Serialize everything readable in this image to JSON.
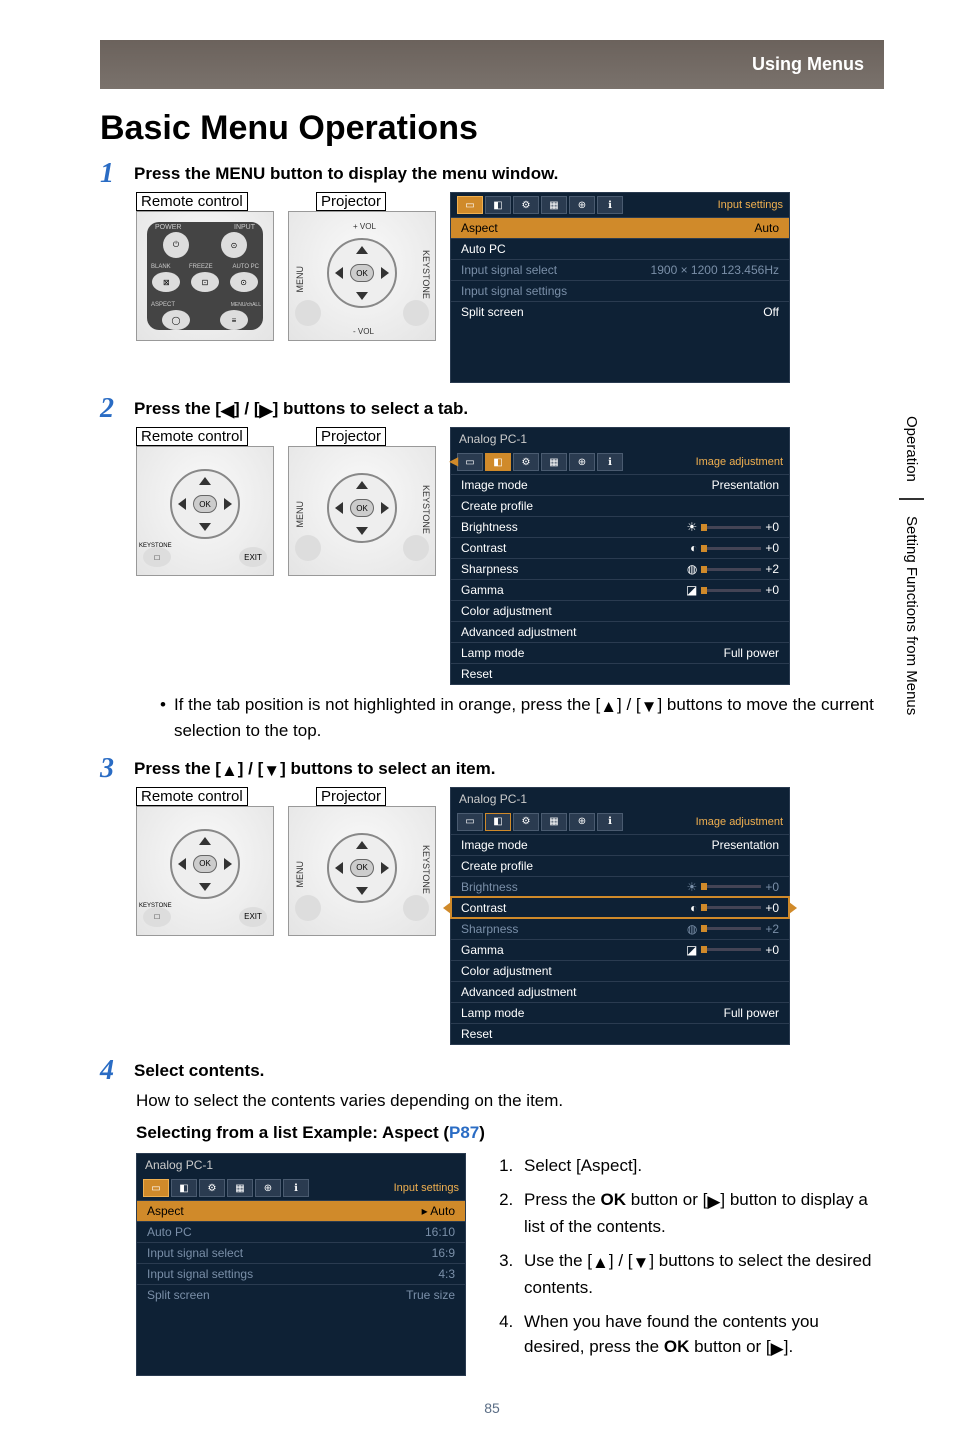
{
  "header": {
    "section": "Using Menus"
  },
  "title": "Basic Menu Operations",
  "side_tabs": [
    "Operation",
    "Setting Functions from Menus"
  ],
  "steps": {
    "s1": {
      "num": "1",
      "text": "Press the MENU button to display the menu window.",
      "remote_label": "Remote control",
      "projector_label": "Projector"
    },
    "s2": {
      "num": "2",
      "text_pre": "Press the [",
      "text_mid": "] / [",
      "text_post": "] buttons to select a tab.",
      "remote_label": "Remote control",
      "projector_label": "Projector",
      "bullet_pre": "If the tab position is not highlighted in orange, press the [",
      "bullet_mid": "] / [",
      "bullet_post": "] buttons to move the current selection to the top."
    },
    "s3": {
      "num": "3",
      "text_pre": "Press the [",
      "text_mid": "] / [",
      "text_post": "] buttons to select an item.",
      "remote_label": "Remote control",
      "projector_label": "Projector"
    },
    "s4": {
      "num": "4",
      "text": "Select contents.",
      "body": "How to select the contents varies depending on the item.",
      "subhead_pre": "Selecting from a list   Example: Aspect (",
      "subhead_link": "P87",
      "subhead_post": ")",
      "instructions": {
        "i1": "Select [Aspect].",
        "i2_pre": "Press the ",
        "i2_ok": "OK",
        "i2_mid": " button or [",
        "i2_post": "] button to display a list of the contents.",
        "i3_pre": "Use the [",
        "i3_mid": "] / [",
        "i3_post": "] buttons to select the desired contents.",
        "i4_pre": "When you have found the contents you desired, press the ",
        "i4_ok": "OK",
        "i4_mid": " button or [",
        "i4_post": "]."
      }
    }
  },
  "osd1": {
    "tab_label": "Input settings",
    "tabs_info_glyph": "ℹ",
    "rows": [
      {
        "label": "Aspect",
        "value": "Auto",
        "sel": true
      },
      {
        "label": "Auto PC",
        "value": ""
      },
      {
        "label": "Input signal select",
        "value": "1900 × 1200 123.456Hz",
        "dim": true
      },
      {
        "label": "Input signal settings",
        "value": "",
        "dim": true
      },
      {
        "label": "Split screen",
        "value": "Off"
      }
    ]
  },
  "osd2": {
    "title": "Analog PC-1",
    "tab_label": "Image adjustment",
    "rows": [
      {
        "label": "Image mode",
        "value": "Presentation"
      },
      {
        "label": "Create profile",
        "value": ""
      },
      {
        "label": "Brightness",
        "value": "☀ +0",
        "slider": true
      },
      {
        "label": "Contrast",
        "value": "◐ +0",
        "slider": true
      },
      {
        "label": "Sharpness",
        "value": "◍ +2",
        "slider": true
      },
      {
        "label": "Gamma",
        "value": "◪ +0",
        "slider": true
      },
      {
        "label": "Color adjustment",
        "value": ""
      },
      {
        "label": "Advanced adjustment",
        "value": ""
      },
      {
        "label": "Lamp mode",
        "value": "Full power"
      },
      {
        "label": "Reset",
        "value": ""
      }
    ]
  },
  "osd3": {
    "title": "Analog PC-1",
    "tab_label": "Image adjustment",
    "rows": [
      {
        "label": "Image mode",
        "value": "Presentation"
      },
      {
        "label": "Create profile",
        "value": ""
      },
      {
        "label": "Brightness",
        "value": "☀ +0",
        "slider": true,
        "dim": true
      },
      {
        "label": "Contrast",
        "value": "◐ +0",
        "slider": true,
        "frame": true
      },
      {
        "label": "Sharpness",
        "value": "◍ +2",
        "slider": true,
        "dim": true
      },
      {
        "label": "Gamma",
        "value": "◪ +0",
        "slider": true
      },
      {
        "label": "Color adjustment",
        "value": ""
      },
      {
        "label": "Advanced adjustment",
        "value": ""
      },
      {
        "label": "Lamp mode",
        "value": "Full power"
      },
      {
        "label": "Reset",
        "value": ""
      }
    ]
  },
  "osd4": {
    "title": "Analog PC-1",
    "tab_label": "Input settings",
    "rows": [
      {
        "label": "Aspect",
        "value": "▸ Auto",
        "sel": true
      },
      {
        "label": "Auto PC",
        "value": "16:10",
        "dim": true
      },
      {
        "label": "Input signal select",
        "value": "16:9",
        "dim": true
      },
      {
        "label": "Input signal settings",
        "value": "4:3",
        "dim": true
      },
      {
        "label": "Split screen",
        "value": "True size",
        "dim": true
      }
    ]
  },
  "device_labels": {
    "power": "POWER",
    "input": "INPUT",
    "blank": "BLANK",
    "freeze": "FREEZE",
    "autopc": "AUTO PC",
    "aspect": "ASPECT",
    "menu_small": "MENU/chALL",
    "menu": "MENU",
    "keystone": "KEYSTONE",
    "keystone_lc": "KEYSTONE",
    "ok": "OK",
    "exit": "EXIT",
    "vol_up": "+ VOL",
    "vol_down": "- VOL"
  },
  "glyphs": {
    "left": "◀",
    "right": "▶",
    "up": "▲",
    "down": "▼"
  },
  "footer": {
    "page": "85"
  }
}
